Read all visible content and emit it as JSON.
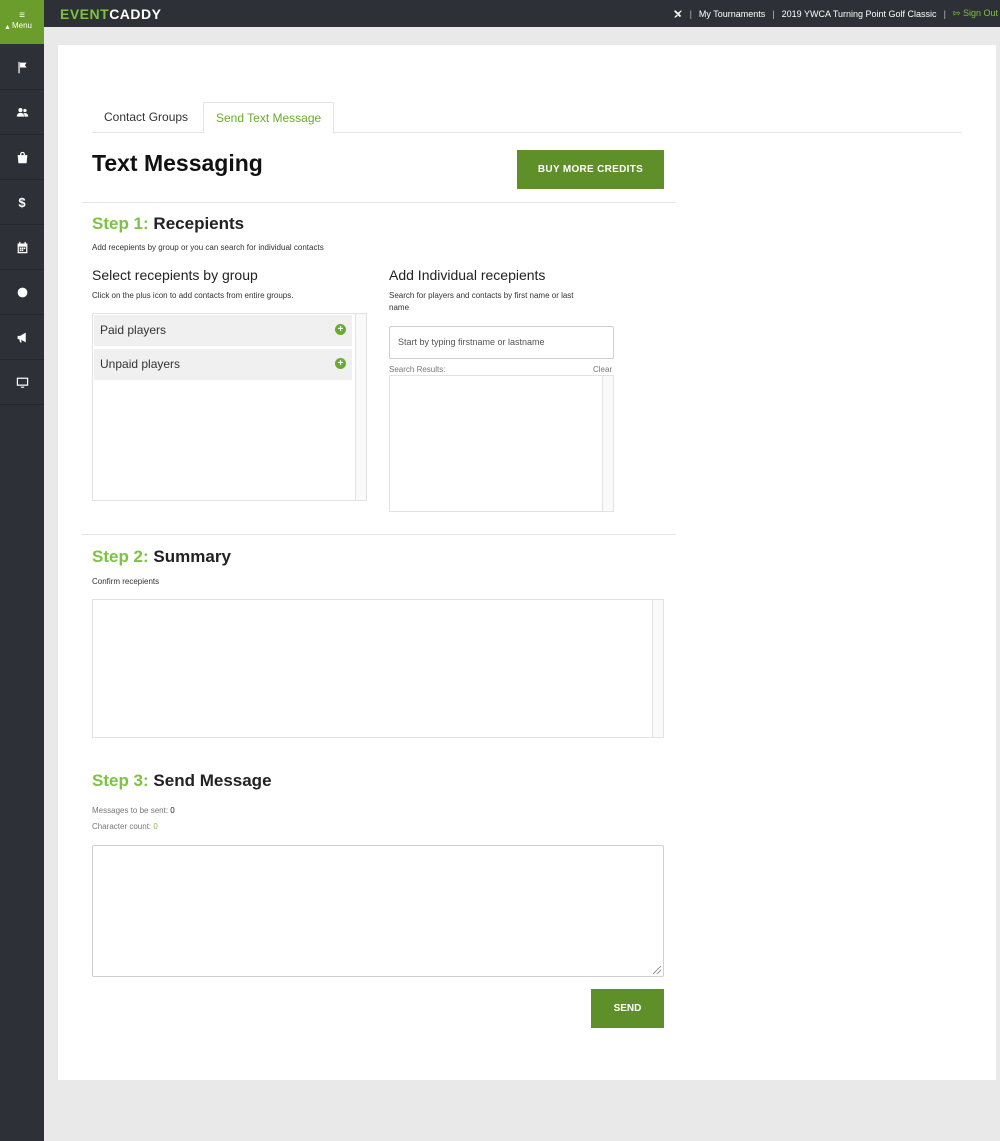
{
  "app": {
    "logo_part1": "EVENT",
    "logo_part2": "CADDY"
  },
  "sidebar": {
    "menu_label": "Menu",
    "items": [
      {
        "icon": "flag-icon"
      },
      {
        "icon": "users-icon"
      },
      {
        "icon": "bag-icon"
      },
      {
        "icon": "dollar-icon",
        "glyph": "$"
      },
      {
        "icon": "calendar-icon"
      },
      {
        "icon": "circle-icon"
      },
      {
        "icon": "megaphone-icon"
      },
      {
        "icon": "monitor-icon"
      }
    ]
  },
  "topnav": {
    "tournaments": "My Tournaments",
    "event": "2019 YWCA Turning Point Golf Classic",
    "signout": "Sign Out",
    "separator": "|"
  },
  "tabs": [
    {
      "label": "Contact Groups",
      "active": false
    },
    {
      "label": "Send Text Message",
      "active": true
    }
  ],
  "page": {
    "title": "Text Messaging",
    "buy_credits": "BUY MORE CREDITS"
  },
  "step1": {
    "num": "Step 1:",
    "title": "Recepients",
    "desc": "Add recepients by group or you can search for individual contacts",
    "group_heading": "Select recepients by group",
    "group_desc": "Click on the plus icon to add contacts from entire groups.",
    "groups": [
      "Paid players",
      "Unpaid players"
    ],
    "individual_heading": "Add Individual recepients",
    "individual_desc_line1": "Search for players and contacts by first name or last",
    "individual_desc_line2": "name",
    "search_placeholder": "Start by typing firstname or lastname",
    "results_label": "Search Results:",
    "clear_label": "Clear"
  },
  "step2": {
    "num": "Step 2:",
    "title": "Summary",
    "desc": "Confirm recepients"
  },
  "step3": {
    "num": "Step 3:",
    "title": "Send Message",
    "messages_label": "Messages to be sent:",
    "messages_count": "0",
    "char_label": "Character count:",
    "char_count": "0",
    "send": "SEND"
  },
  "colors": {
    "accent": "#7dc242",
    "button": "#5f8f29",
    "sidebar": "#2d3137"
  }
}
